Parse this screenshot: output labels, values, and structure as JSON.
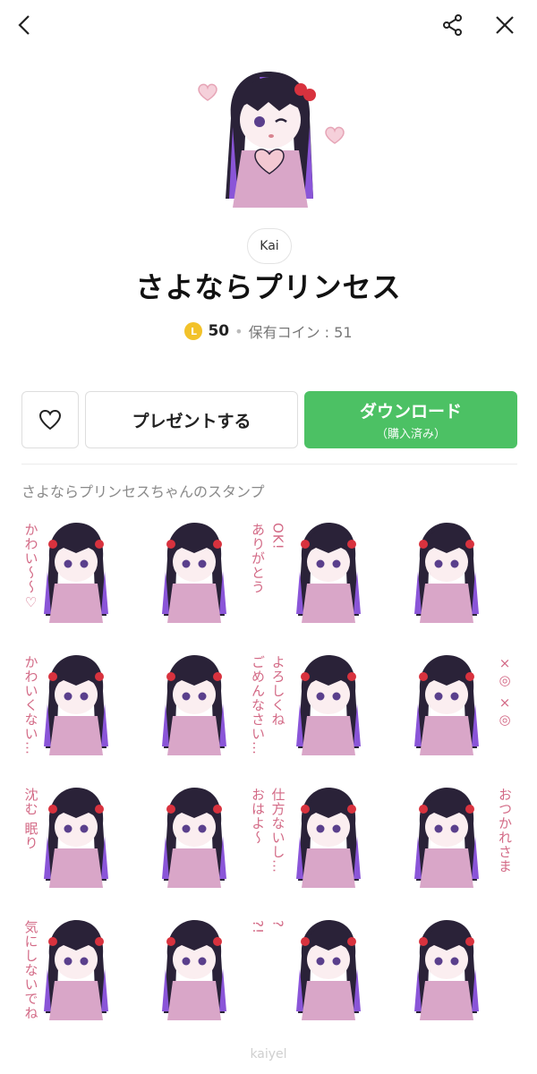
{
  "header": {
    "back_icon": "chevron-left-icon",
    "share_icon": "share-icon",
    "close_icon": "close-icon"
  },
  "author": "Kai",
  "title": "さよならプリンセス",
  "price": {
    "coin_glyph": "L",
    "amount": "50",
    "separator": "•",
    "owned_coins": "保有コイン : 51"
  },
  "actions": {
    "favorite_icon": "heart-outline-icon",
    "present_label": "プレゼントする",
    "download_label": "ダウンロード",
    "download_sub": "（購入済み）"
  },
  "section_label": "さよならプリンセスちゃんのスタンプ",
  "stickers": [
    {
      "text": "かわい〜〜♡"
    },
    {
      "text": "ありがとう"
    },
    {
      "text": "OK!"
    },
    {
      "text": ""
    },
    {
      "text": "かわいくない…"
    },
    {
      "text": "ごめんなさい…"
    },
    {
      "text": "よろしくね"
    },
    {
      "text": "×◎ ×◎"
    },
    {
      "text": "沈む 眠り"
    },
    {
      "text": "おはよ〜"
    },
    {
      "text": "仕方ないし…"
    },
    {
      "text": "おつかれさま"
    },
    {
      "text": "気にしないでね"
    },
    {
      "text": "?!"
    },
    {
      "text": "?"
    },
    {
      "text": ""
    }
  ],
  "colors": {
    "accent_green": "#4cc164",
    "coin": "#f2c22a",
    "hair": "#2a2238",
    "hair_streak": "#8a55d8",
    "outfit": "#d9a6c8",
    "bow": "#d8323e",
    "caption_pink": "#d36a86"
  },
  "footer_text": "kaiyel"
}
